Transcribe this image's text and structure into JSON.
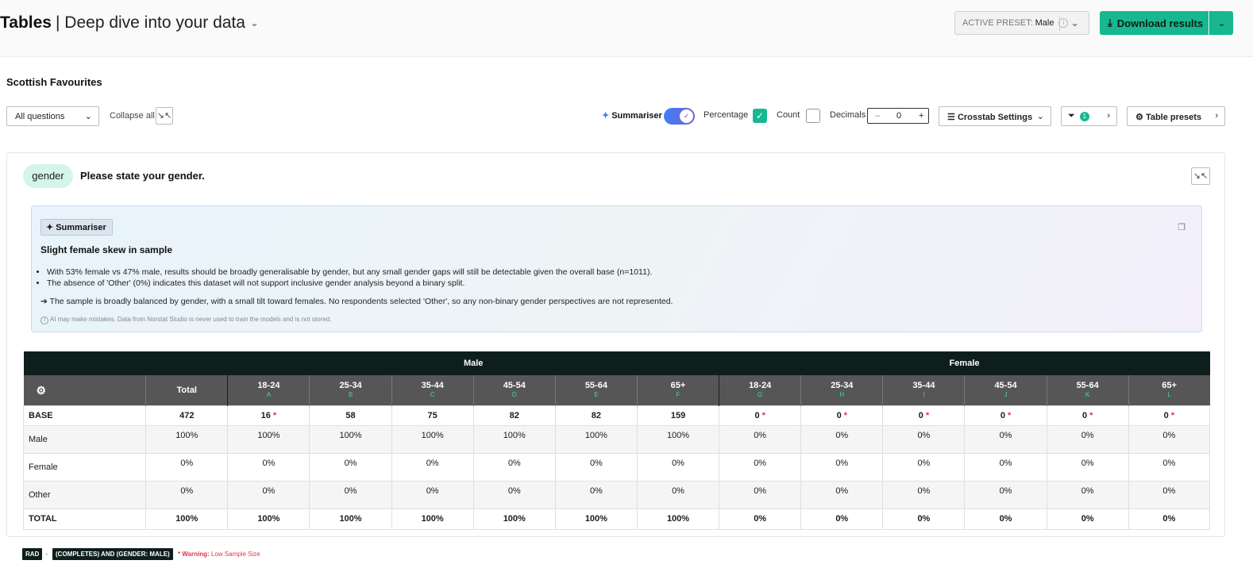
{
  "header": {
    "app_title": "Tables",
    "page_subtitle": "| Deep dive into your data",
    "preset_label": "ACTIVE PRESET:",
    "preset_value": "Male",
    "download_label": "Download results"
  },
  "project_title": "Scottish Favourites",
  "filters": {
    "questions_select": "All questions",
    "collapse_label": "Collapse all",
    "summariser_label": "Summariser",
    "summariser_on": true,
    "percentage_label": "Percentage",
    "percentage_checked": true,
    "count_label": "Count",
    "count_checked": false,
    "decimals_label": "Decimals",
    "decimals_value": "0",
    "crosstab_label": "Crosstab Settings",
    "filter_count": "1",
    "table_presets_label": "Table presets"
  },
  "question": {
    "variable": "gender",
    "text": "Please state your gender."
  },
  "summary": {
    "tag": "Summariser",
    "heading": "Slight female skew in sample",
    "bullets": [
      "With 53% female vs 47% male, results should be broadly generalisable by gender, but any small gender gaps will still be detectable given the overall base (n=1011).",
      "The absence of 'Other' (0%) indicates this dataset will not support inclusive gender analysis beyond a binary split."
    ],
    "conclusion": "➔ The sample is broadly balanced by gender, with a small tilt toward females. No respondents selected 'Other', so any non-binary gender perspectives are not represented.",
    "disclaimer": "AI may make mistakes. Data from Norstat Studio is never used to train the models and is not stored."
  },
  "table": {
    "groups": [
      "Male",
      "Female"
    ],
    "total_header": "Total",
    "columns": [
      {
        "label": "18-24",
        "letter": "A"
      },
      {
        "label": "25-34",
        "letter": "B"
      },
      {
        "label": "35-44",
        "letter": "C"
      },
      {
        "label": "45-54",
        "letter": "D"
      },
      {
        "label": "55-64",
        "letter": "E"
      },
      {
        "label": "65+",
        "letter": "F"
      },
      {
        "label": "18-24",
        "letter": "G"
      },
      {
        "label": "25-34",
        "letter": "H"
      },
      {
        "label": "35-44",
        "letter": "I"
      },
      {
        "label": "45-54",
        "letter": "J"
      },
      {
        "label": "55-64",
        "letter": "K"
      },
      {
        "label": "65+",
        "letter": "L"
      }
    ],
    "base_row": {
      "label": "BASE",
      "total": "472",
      "cells": [
        "16",
        "58",
        "75",
        "82",
        "82",
        "159",
        "0",
        "0",
        "0",
        "0",
        "0",
        "0"
      ],
      "low_sample": [
        true,
        false,
        false,
        false,
        false,
        false,
        true,
        true,
        true,
        true,
        true,
        true
      ]
    },
    "rows": [
      {
        "label": "Male",
        "total": "100%",
        "cells": [
          "100%",
          "100%",
          "100%",
          "100%",
          "100%",
          "100%",
          "0%",
          "0%",
          "0%",
          "0%",
          "0%",
          "0%"
        ]
      },
      {
        "label": "Female",
        "total": "0%",
        "cells": [
          "0%",
          "0%",
          "0%",
          "0%",
          "0%",
          "0%",
          "0%",
          "0%",
          "0%",
          "0%",
          "0%",
          "0%"
        ]
      },
      {
        "label": "Other",
        "total": "0%",
        "cells": [
          "0%",
          "0%",
          "0%",
          "0%",
          "0%",
          "0%",
          "0%",
          "0%",
          "0%",
          "0%",
          "0%",
          "0%"
        ]
      }
    ],
    "total_row": {
      "label": "TOTAL",
      "total": "100%",
      "cells": [
        "100%",
        "100%",
        "100%",
        "100%",
        "100%",
        "100%",
        "0%",
        "0%",
        "0%",
        "0%",
        "0%",
        "0%"
      ]
    }
  },
  "footer": {
    "tag1": "RAD",
    "separator": "-",
    "tag2": "(COMPLETES) AND (GENDER: MALE)",
    "warning_label": "* Warning:",
    "warning_text": "Low Sample Size"
  },
  "colors": {
    "accent": "#17b890",
    "table_header_dark": "#0e1e1c",
    "table_subheader": "#565656",
    "warning": "#e0344c"
  }
}
